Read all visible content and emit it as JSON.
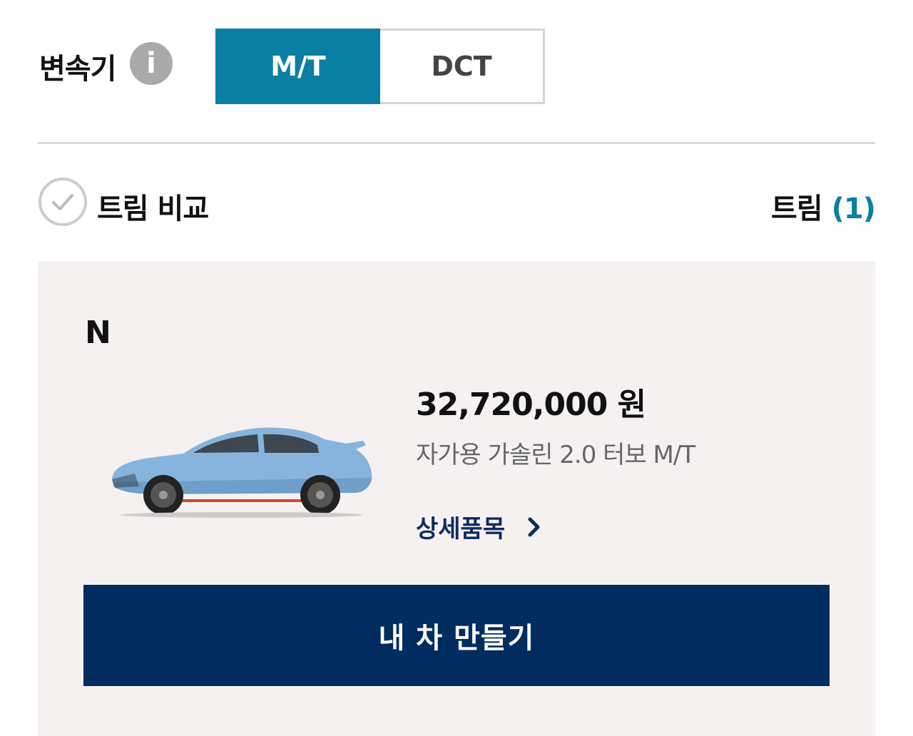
{
  "transmission": {
    "label": "변속기",
    "options": [
      {
        "label": "M/T",
        "selected": true
      },
      {
        "label": "DCT",
        "selected": false
      }
    ]
  },
  "trim_header": {
    "compare_label": "트림 비교",
    "trim_label": "트림",
    "trim_count": "(1)"
  },
  "trim_card": {
    "name": "N",
    "price": "32,720,000 원",
    "spec": "자가용 가솔린 2.0 터보 M/T",
    "detail_link": "상세품목",
    "build_button": "내 차 만들기"
  },
  "colors": {
    "accent": "#0b7fa3",
    "primary_button": "#002c5f",
    "card_background": "#f5f1f1"
  }
}
